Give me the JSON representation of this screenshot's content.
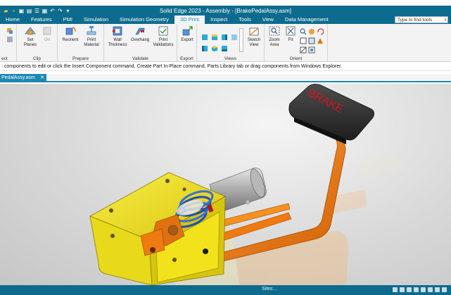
{
  "window": {
    "title": "Solid Edge 2023 - Assembly - [BrakePedalAssy.asm]"
  },
  "tabs": [
    "Home",
    "Features",
    "PMI",
    "Simulation",
    "Simulation Geometry",
    "3D Print",
    "Inspect",
    "Tools",
    "View",
    "Data Management"
  ],
  "active_tab": "3D Print",
  "search": {
    "placeholder": "Type to find tools"
  },
  "ribbon": {
    "groups": {
      "select": "ect",
      "clip": "Clip",
      "prepare": "Prepare",
      "validate": "Validate",
      "export": "Export",
      "views": "Views",
      "orient": "Orient"
    },
    "buttons": {
      "set_planes": "Set Planes",
      "on": "On",
      "reorient": "Reorient",
      "print_material": "Print Material",
      "wall_thickness": "Wall Thickness",
      "overhang": "Overhang",
      "print_validations": "Print Validations",
      "export": "Export",
      "sketch_view": "Sketch View",
      "zoom_area": "Zoom Area",
      "fit": "Fit"
    }
  },
  "prompt": ": components to edit or click the Insert Component command, Create Part In-Place command, Parts Library tab or drag components from Windows Explorer.",
  "document_tab": {
    "label": "PedalAssy.asm",
    "close": "✕"
  },
  "model": {
    "pedal_text": "BRAKE"
  },
  "colors": {
    "titlebar": "#0d6c8e",
    "active_tab_text": "#1f8fb8",
    "bracket_yellow": "#f2e21b",
    "pedal_orange": "#f07a10",
    "pad_dark": "#3a3a3a",
    "pad_text": "#d8141c"
  },
  "statusbar": {
    "text": "Sites..."
  }
}
